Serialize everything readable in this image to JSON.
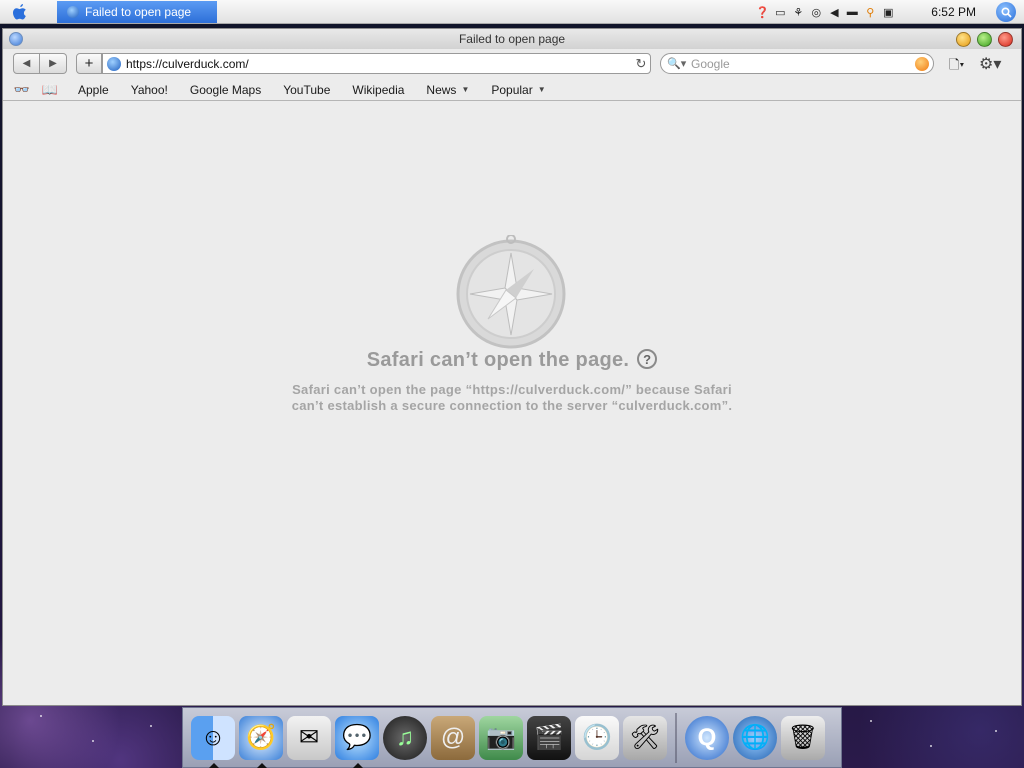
{
  "menubar": {
    "active_window_title": "Failed to open page",
    "clock": "6:52 PM",
    "tray_icons": [
      "help-icon",
      "battery-icon",
      "network-icon",
      "cd-icon",
      "volume-icon",
      "display-icon",
      "key-icon",
      "monitor-icon"
    ]
  },
  "window": {
    "title": "Failed to open page",
    "controls": [
      "minimize",
      "zoom",
      "close"
    ]
  },
  "toolbar": {
    "back_glyph": "◀",
    "forward_glyph": "▶",
    "add_glyph": "+",
    "url": "https://culverduck.com/",
    "reload_glyph": "↻",
    "search_placeholder": "Google",
    "page_menu_glyph": "▾",
    "gear_glyph": "⚙▾"
  },
  "bookmarks": {
    "reader_glyph": "👓",
    "book_glyph": "📖",
    "items": [
      {
        "label": "Apple",
        "has_menu": false
      },
      {
        "label": "Yahoo!",
        "has_menu": false
      },
      {
        "label": "Google Maps",
        "has_menu": false
      },
      {
        "label": "YouTube",
        "has_menu": false
      },
      {
        "label": "Wikipedia",
        "has_menu": false
      },
      {
        "label": "News",
        "has_menu": true
      },
      {
        "label": "Popular",
        "has_menu": true
      }
    ]
  },
  "error": {
    "title": "Safari can’t open the page.",
    "help_glyph": "?",
    "desc_line1": "Safari can’t open the page “https://culverduck.com/” because Safari",
    "desc_line2": "can’t establish a secure connection to the server “culverduck.com”."
  },
  "dock": {
    "items": [
      {
        "name": "finder",
        "glyph": "☺",
        "running": true
      },
      {
        "name": "safari",
        "glyph": "🧭",
        "running": true
      },
      {
        "name": "mail",
        "glyph": "✉",
        "running": false
      },
      {
        "name": "ichat",
        "glyph": "💬",
        "running": true
      },
      {
        "name": "itunes",
        "glyph": "♫",
        "running": false
      },
      {
        "name": "address-book",
        "glyph": "@",
        "running": false
      },
      {
        "name": "iphoto",
        "glyph": "📷",
        "running": false
      },
      {
        "name": "imovie",
        "glyph": "🎬",
        "running": false
      },
      {
        "name": "ical",
        "glyph": "🕒",
        "running": false
      },
      {
        "name": "utilities",
        "glyph": "🛠",
        "running": false
      }
    ],
    "right_items": [
      {
        "name": "quicktime",
        "glyph": "Q"
      },
      {
        "name": "network-browser",
        "glyph": "🌐"
      },
      {
        "name": "trash",
        "glyph": "🗑"
      }
    ]
  }
}
